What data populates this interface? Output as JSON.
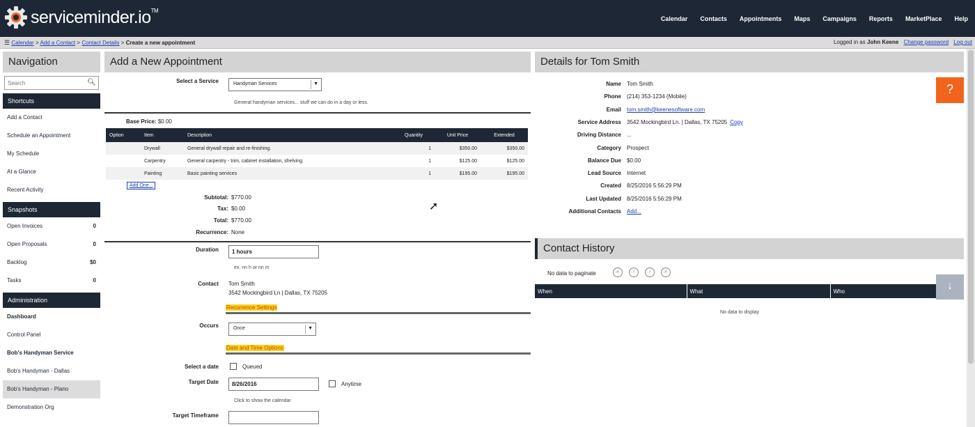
{
  "app": {
    "logo_text": "serviceminder.io",
    "logo_tm": "TM"
  },
  "topnav": [
    "Calendar",
    "Contacts",
    "Appointments",
    "Maps",
    "Campaigns",
    "Reports",
    "MarketPlace",
    "Help"
  ],
  "breadcrumb": {
    "items": [
      "Calendar",
      "Add a Contact",
      "Contact Details"
    ],
    "current": "Create a new appointment",
    "separator": ">"
  },
  "login": {
    "prefix": "Logged in as",
    "user": "John Keene",
    "change_password": "Change password",
    "logout": "Log out"
  },
  "nav": {
    "title": "Navigation",
    "search_placeholder": "Search",
    "sections": [
      {
        "title": "Shortcuts",
        "items": [
          {
            "label": "Add a Contact"
          },
          {
            "label": "Schedule an Appointment"
          },
          {
            "label": "My Schedule"
          },
          {
            "label": "At a Glance"
          },
          {
            "label": "Recent Activity"
          }
        ]
      },
      {
        "title": "Snapshots",
        "items": [
          {
            "label": "Open Invoices",
            "count": "0"
          },
          {
            "label": "Open Proposals",
            "count": "0"
          },
          {
            "label": "Backlog",
            "count": "$0"
          },
          {
            "label": "Tasks",
            "count": "0"
          }
        ]
      },
      {
        "title": "Administration",
        "items": [
          {
            "label": "Dashboard",
            "bold": true
          },
          {
            "label": "Control Panel"
          },
          {
            "label": "Bob's Handyman Service",
            "bold": true
          },
          {
            "label": "Bob's Handyman - Dallas"
          },
          {
            "label": "Bob's Handyman - Plano",
            "selected": true
          },
          {
            "label": "Demonstration Org"
          }
        ]
      }
    ]
  },
  "appointment": {
    "title": "Add a New Appointment",
    "select_service_label": "Select a Service",
    "service_value": "Handyman Services",
    "service_desc": "General handyman services... stuff we can do in a day or less.",
    "base_price_label": "Base Price:",
    "base_price": "$0.00",
    "table": {
      "headers": [
        "Option",
        "Item",
        "Description",
        "Quantity",
        "Unit Price",
        "Extended"
      ],
      "rows": [
        [
          "",
          "Drywall",
          "General drywall repair and re-finishing.",
          "1",
          "$350.00",
          "$350.00"
        ],
        [
          "",
          "Carpentry",
          "General carpentry - trim, cabinet installation, shelving.",
          "1",
          "$125.00",
          "$125.00"
        ],
        [
          "",
          "Painting",
          "Basic painting services",
          "1",
          "$195.00",
          "$195.00"
        ]
      ]
    },
    "add_one": "Add One...",
    "subtotal_label": "Subtotal:",
    "subtotal": "$770.00",
    "tax_label": "Tax:",
    "tax": "$0.00",
    "total_label": "Total:",
    "total": "$770.00",
    "recurrence_label": "Recurrence:",
    "recurrence": "None",
    "duration_label": "Duration",
    "duration_value": "1 hours",
    "duration_hint": "ex. nn h or nn m",
    "contact_label": "Contact",
    "contact_name": "Tom Smith",
    "contact_address": "3542 Mockingbird Ln | Dallas, TX 75205",
    "recurrence_settings": "Recurrence Settings",
    "occurs_label": "Occurs",
    "occurs_value": "Once",
    "date_time_options": "Date and Time Options",
    "select_date_label": "Select a date",
    "queued_label": "Queued",
    "target_date_label": "Target Date",
    "target_date": "8/26/2016",
    "anytime_label": "Anytime",
    "calendar_hint": "Click to show the calendar",
    "target_timeframe_label": "Target Timeframe"
  },
  "details": {
    "title": "Details for Tom Smith",
    "fields": [
      {
        "label": "Name",
        "value": "Tom Smith"
      },
      {
        "label": "Phone",
        "value": "(214) 353-1234 (Mobile)"
      },
      {
        "label": "Email",
        "value": "tom.smith@keenesoftware.com",
        "link": true
      },
      {
        "label": "Service Address",
        "value": "3542 Mockingbird Ln. | Dallas, TX 75205",
        "extra": "Copy"
      },
      {
        "label": "Driving Distance",
        "value": "..."
      },
      {
        "label": "Category",
        "value": "Prospect"
      },
      {
        "label": "Balance Due",
        "value": "$0.00"
      },
      {
        "label": "Lead Source",
        "value": "Internet"
      },
      {
        "label": "Created",
        "value": "8/25/2016 5:56:29 PM"
      },
      {
        "label": "Last Updated",
        "value": "8/25/2016 5:56:29 PM"
      },
      {
        "label": "Additional Contacts",
        "value": "Add...",
        "link": true
      }
    ],
    "help": "?"
  },
  "history": {
    "title": "Contact History",
    "paginate": "No data to paginate",
    "pager": [
      "«",
      "‹",
      "›",
      "»"
    ],
    "headers": [
      "When",
      "What",
      "Who"
    ],
    "empty": "No data to display"
  }
}
